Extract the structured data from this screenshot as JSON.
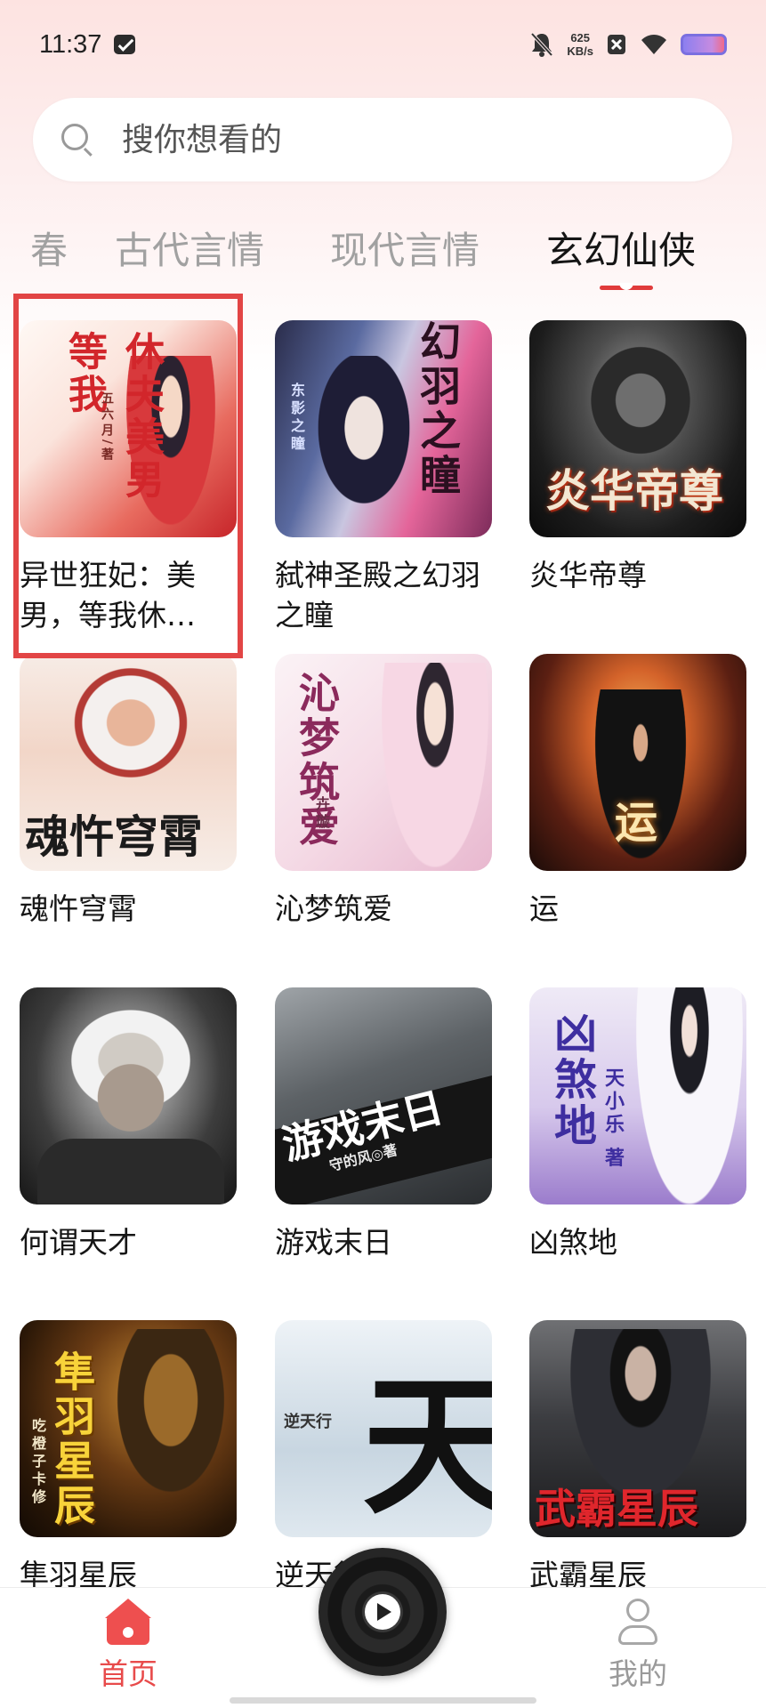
{
  "status_bar": {
    "time": "11:37",
    "net_speed_value": "625",
    "net_speed_unit": "KB/s"
  },
  "search": {
    "placeholder": "搜你想看的"
  },
  "tabs": [
    {
      "label": "春",
      "active": false
    },
    {
      "label": "古代言情",
      "active": false
    },
    {
      "label": "现代言情",
      "active": false
    },
    {
      "label": "玄幻仙侠",
      "active": true
    }
  ],
  "books": [
    {
      "title": "异世狂妃：美男，等我休…",
      "cover_text": "休夫美男等我",
      "cover_sub": "五六月/著",
      "highlighted": true
    },
    {
      "title": "弑神圣殿之幻羽之瞳",
      "cover_text": "幻羽之瞳",
      "cover_sub": "东影之瞳"
    },
    {
      "title": "炎华帝尊",
      "cover_text": "炎华帝尊"
    },
    {
      "title": "魂忤穹霄",
      "cover_text": "魂忤穹霄"
    },
    {
      "title": "沁梦筑爱",
      "cover_text": "沁梦筑爱",
      "cover_sub": "卉璇"
    },
    {
      "title": "运",
      "cover_text": "运"
    },
    {
      "title": "何谓天才",
      "cover_text": ""
    },
    {
      "title": "游戏末日",
      "cover_text": "游戏末日",
      "cover_sub": "守的风◎著"
    },
    {
      "title": "凶煞地",
      "cover_text": "凶煞地",
      "cover_sub": "天小乐 著"
    },
    {
      "title": "隼羽星辰",
      "cover_text": "隼羽星辰",
      "cover_sub": "吃橙子卡修"
    },
    {
      "title": "逆天行",
      "cover_text": "天",
      "cover_sub": "逆天行"
    },
    {
      "title": "武霸星辰",
      "cover_text": "武霸星辰"
    }
  ],
  "bottom_nav": {
    "home_label": "首页",
    "mine_label": "我的"
  },
  "colors": {
    "accent": "#e84b4b",
    "highlight_border": "#e24545"
  }
}
